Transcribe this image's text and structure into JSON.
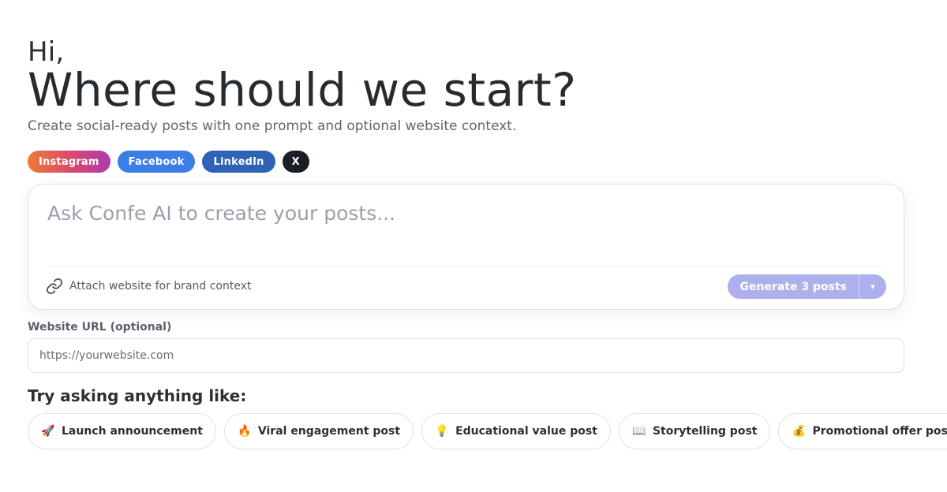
{
  "header": {
    "greeting": "Hi,",
    "headline": "Where should we start?",
    "subtitle": "Create social-ready posts with one prompt and optional website context."
  },
  "platforms": [
    {
      "label": "Instagram",
      "color": "#d9476e"
    },
    {
      "label": "Facebook",
      "color": "#3b7ee6"
    },
    {
      "label": "LinkedIn",
      "color": "#2d62b5"
    },
    {
      "label": "X",
      "color": "#1b1e24"
    }
  ],
  "composer": {
    "placeholder": "Ask Confe AI to create your posts...",
    "value": "",
    "attach_icon": "link-icon",
    "attach_label": "Attach website for brand context",
    "generate_label": "Generate 3 posts",
    "dropdown_icon": "▾",
    "generate_color": "#aeb0ee"
  },
  "website": {
    "label": "Website URL (optional)",
    "placeholder": "https://yourwebsite.com",
    "value": ""
  },
  "suggestions": {
    "heading": "Try asking anything like:",
    "items": [
      {
        "emoji": "🚀",
        "icon": "rocket-icon",
        "label": "Launch announcement"
      },
      {
        "emoji": "🔥",
        "icon": "fire-icon",
        "label": "Viral engagement post"
      },
      {
        "emoji": "💡",
        "icon": "lightbulb-icon",
        "label": "Educational value post"
      },
      {
        "emoji": "📖",
        "icon": "book-icon",
        "label": "Storytelling post"
      },
      {
        "emoji": "💰",
        "icon": "money-bag-icon",
        "label": "Promotional offer post"
      }
    ]
  }
}
